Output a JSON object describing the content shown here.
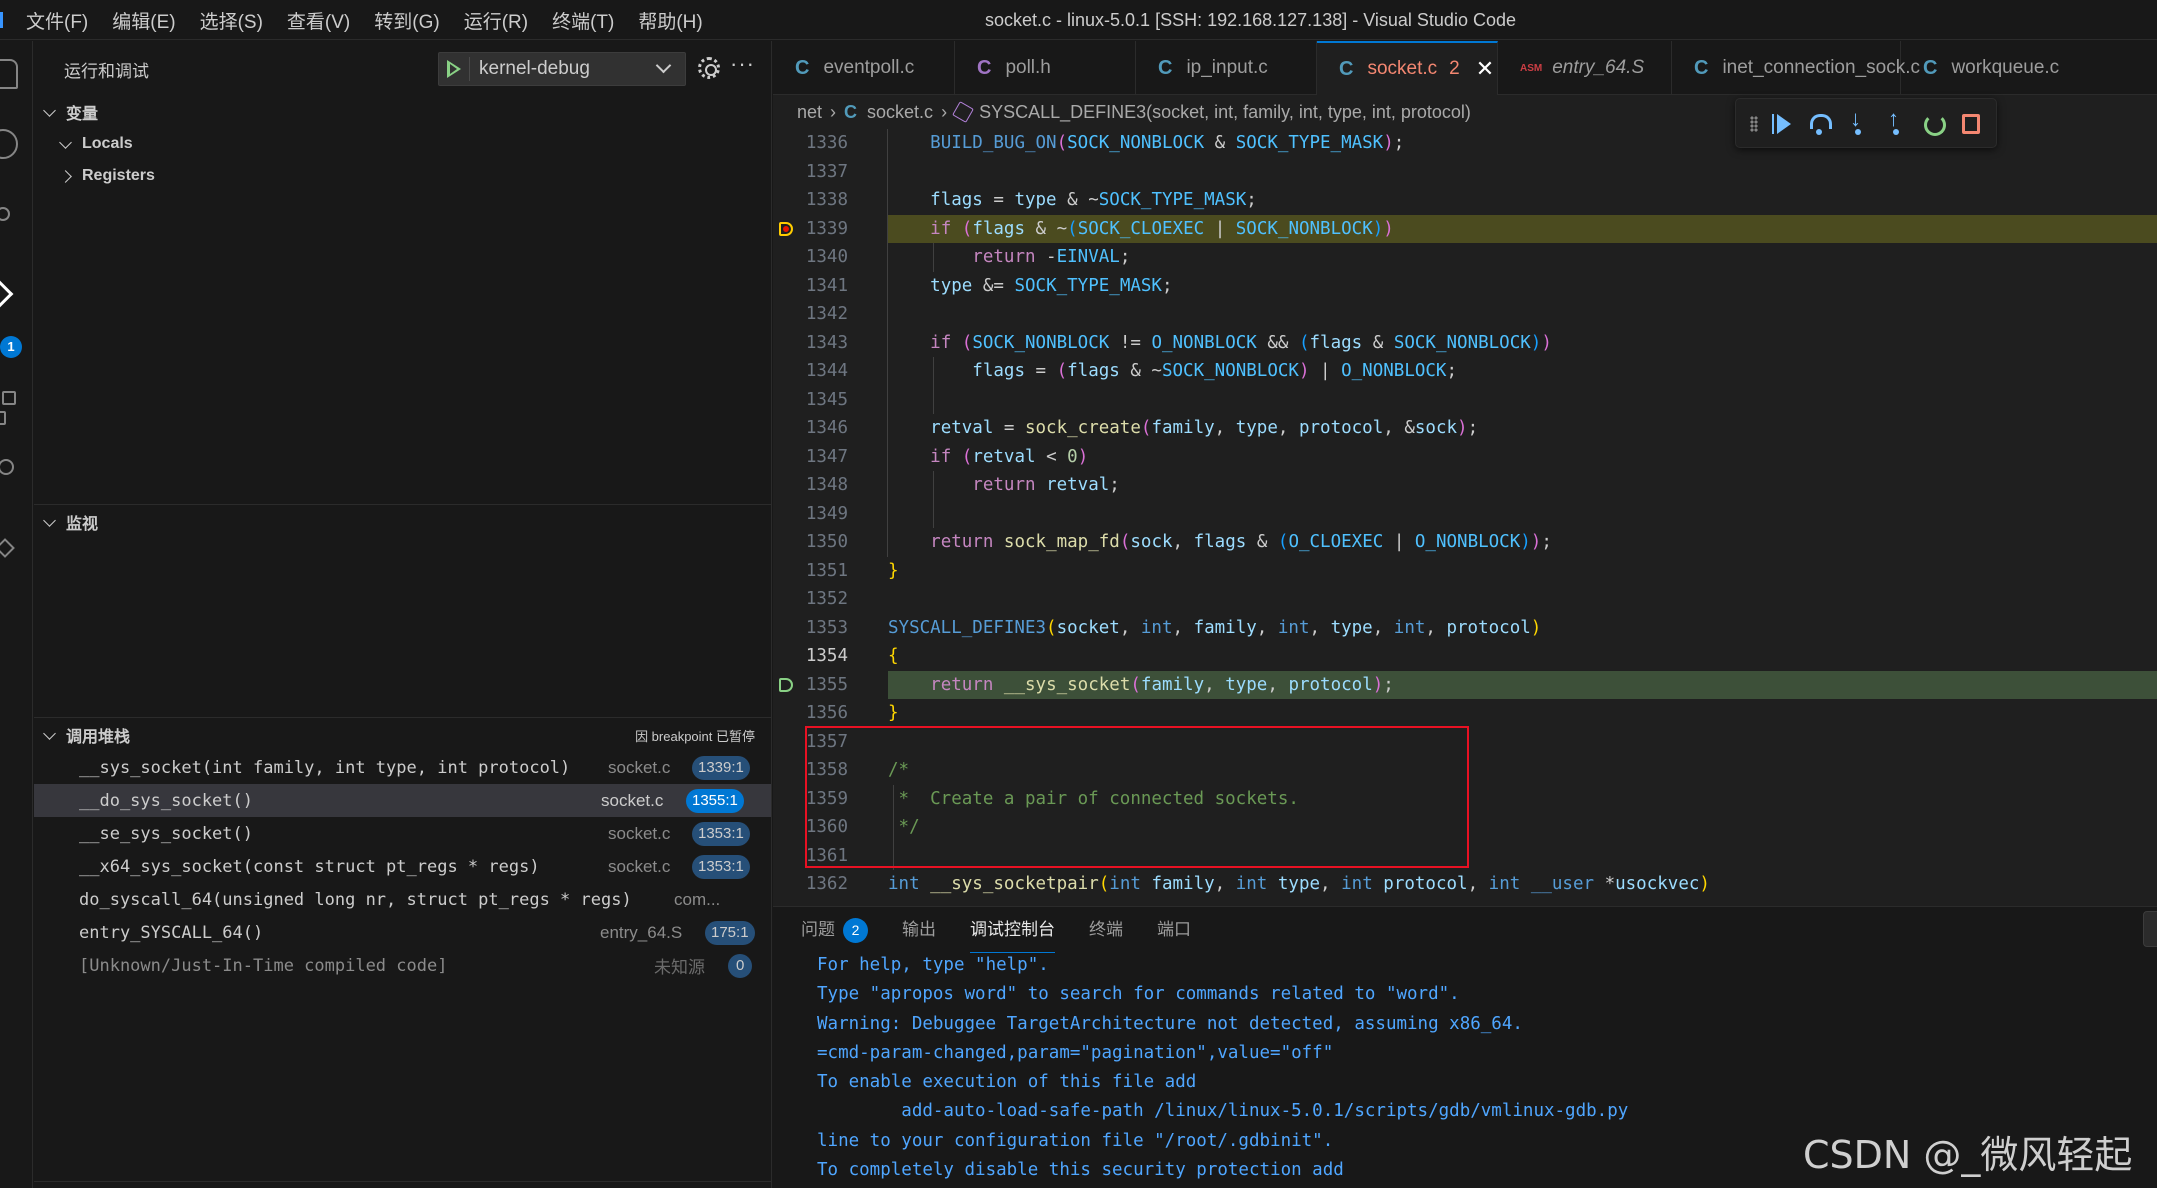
{
  "titlebar": {
    "menus": [
      "文件(F)",
      "编辑(E)",
      "选择(S)",
      "查看(V)",
      "转到(G)",
      "运行(R)",
      "终端(T)",
      "帮助(H)"
    ],
    "window_title": "socket.c - linux-5.0.1 [SSH: 192.168.127.138] - Visual Studio Code"
  },
  "activitybar": {
    "icons": [
      "files-icon",
      "search-icon",
      "source-control-icon",
      "run-debug-icon",
      "extensions-icon",
      "remote-explorer-icon",
      "testing-icon"
    ],
    "debug_badge": "1"
  },
  "sidebar": {
    "title": "运行和调试",
    "debug_config": "kernel-debug",
    "variables": {
      "header": "变量",
      "scopes": [
        {
          "label": "Locals",
          "expanded": true
        },
        {
          "label": "Registers",
          "expanded": false
        }
      ]
    },
    "watch": {
      "header": "监视"
    },
    "callstack": {
      "header": "调用堆栈",
      "paused_reason": "因 breakpoint 已暂停",
      "frames": [
        {
          "fn": "__sys_socket(int family, int type, int protocol)",
          "file": "socket.c",
          "line": "1339:1",
          "selected": false
        },
        {
          "fn": "__do_sys_socket()",
          "file": "socket.c",
          "line": "1355:1",
          "selected": true
        },
        {
          "fn": "__se_sys_socket()",
          "file": "socket.c",
          "line": "1353:1",
          "selected": false
        },
        {
          "fn": "__x64_sys_socket(const struct pt_regs * regs)",
          "file": "socket.c",
          "line": "1353:1",
          "selected": false
        },
        {
          "fn": "do_syscall_64(unsigned long nr, struct pt_regs * regs)",
          "file": "com...",
          "line": "",
          "selected": false
        },
        {
          "fn": "entry_SYSCALL_64()",
          "file": "entry_64.S",
          "line": "175:1",
          "selected": false
        },
        {
          "fn": "[Unknown/Just-In-Time compiled code]",
          "file": "未知源",
          "line": "0",
          "selected": false,
          "dim": true
        }
      ]
    }
  },
  "editor": {
    "tabs": [
      {
        "label": "eventpoll.c",
        "icon": "C",
        "active": false
      },
      {
        "label": "poll.h",
        "icon": "C",
        "active": false
      },
      {
        "label": "ip_input.c",
        "icon": "C",
        "active": false
      },
      {
        "label": "socket.c",
        "icon": "C",
        "active": true,
        "problems": "2",
        "close": "✕"
      },
      {
        "label": "entry_64.S",
        "icon": "ASM",
        "active": false,
        "italic": true
      },
      {
        "label": "inet_connection_sock.c",
        "icon": "C",
        "active": false
      },
      {
        "label": "workqueue.c",
        "icon": "C",
        "active": false
      }
    ],
    "breadcrumbs": {
      "folder": "net",
      "file_icon": "C",
      "file": "socket.c",
      "symbol": "SYSCALL_DEFINE3(socket, int, family, int, type, int, protocol)"
    },
    "debug_toolbar": [
      "drag-grip",
      "continue",
      "step-over",
      "step-into",
      "step-out",
      "restart",
      "stop"
    ],
    "lines": [
      {
        "num": "1336",
        "html": "    <span class='mf'>BUILD_BUG_ON</span><span class='p2'>(</span><span class='m'>SOCK_NONBLOCK</span> & <span class='m'>SOCK_TYPE_MASK</span><span class='p2'>)</span>;"
      },
      {
        "num": "1337",
        "html": ""
      },
      {
        "num": "1338",
        "html": "    <span class='v'>flags</span> = <span class='v'>type</span> & ~<span class='m'>SOCK_TYPE_MASK</span>;"
      },
      {
        "num": "1339",
        "html": "    <span class='k'>if</span> <span class='p2'>(</span><span class='v'>flags</span> & ~<span class='p3'>(</span><span class='m'>SOCK_CLOEXEC</span> | <span class='m'>SOCK_NONBLOCK</span><span class='p3'>)</span><span class='p2'>)</span>",
        "highlight": "yellow",
        "gutter": "breakpoint-paused"
      },
      {
        "num": "1340",
        "html": "        <span class='k'>return</span> -<span class='m'>EINVAL</span>;"
      },
      {
        "num": "1341",
        "html": "    <span class='v'>type</span> &= <span class='m'>SOCK_TYPE_MASK</span>;"
      },
      {
        "num": "1342",
        "html": ""
      },
      {
        "num": "1343",
        "html": "    <span class='k'>if</span> <span class='p2'>(</span><span class='m'>SOCK_NONBLOCK</span> != <span class='m'>O_NONBLOCK</span> && <span class='p3'>(</span><span class='v'>flags</span> & <span class='m'>SOCK_NONBLOCK</span><span class='p3'>)</span><span class='p2'>)</span>"
      },
      {
        "num": "1344",
        "html": "        <span class='v'>flags</span> = <span class='p2'>(</span><span class='v'>flags</span> & ~<span class='m'>SOCK_NONBLOCK</span><span class='p2'>)</span> | <span class='m'>O_NONBLOCK</span>;"
      },
      {
        "num": "1345",
        "html": ""
      },
      {
        "num": "1346",
        "html": "    <span class='v'>retval</span> = <span class='f'>sock_create</span><span class='p2'>(</span><span class='v'>family</span>, <span class='v'>type</span>, <span class='v'>protocol</span>, &<span class='v'>sock</span><span class='p2'>)</span>;"
      },
      {
        "num": "1347",
        "html": "    <span class='k'>if</span> <span class='p2'>(</span><span class='v'>retval</span> < <span class='n'>0</span><span class='p2'>)</span>"
      },
      {
        "num": "1348",
        "html": "        <span class='k'>return</span> <span class='v'>retval</span>;"
      },
      {
        "num": "1349",
        "html": ""
      },
      {
        "num": "1350",
        "html": "    <span class='k'>return</span> <span class='f'>sock_map_fd</span><span class='p2'>(</span><span class='v'>sock</span>, <span class='v'>flags</span> & <span class='p3'>(</span><span class='m'>O_CLOEXEC</span> | <span class='m'>O_NONBLOCK</span><span class='p3'>)</span><span class='p2'>)</span>;"
      },
      {
        "num": "1351",
        "html": "<span class='p1'>}</span>"
      },
      {
        "num": "1352",
        "html": ""
      },
      {
        "num": "1353",
        "html": "<span class='mf'>SYSCALL_DEFINE3</span><span class='p1'>(</span><span class='v'>socket</span>, <span class='t'>int</span>, <span class='v'>family</span>, <span class='t'>int</span>, <span class='v'>type</span>, <span class='t'>int</span>, <span class='v'>protocol</span><span class='p1'>)</span>"
      },
      {
        "num": "1354",
        "html": "<span class='p1'>{</span>",
        "current": true
      },
      {
        "num": "1355",
        "html": "    <span class='k'>return</span> <span class='f'>__sys_socket</span><span class='p2'>(</span><span class='v'>family</span>, <span class='v'>type</span>, <span class='v'>protocol</span><span class='p2'>)</span>;",
        "highlight": "green",
        "gutter": "stack-frame"
      },
      {
        "num": "1356",
        "html": "<span class='p1'>}</span>"
      },
      {
        "num": "1357",
        "html": ""
      },
      {
        "num": "1358",
        "html": "<span class='c'>/*</span>"
      },
      {
        "num": "1359",
        "html": "<span class='c'> *  Create a pair of connected sockets.</span>"
      },
      {
        "num": "1360",
        "html": "<span class='c'> */</span>"
      },
      {
        "num": "1361",
        "html": ""
      },
      {
        "num": "1362",
        "html": "<span class='t'>int</span> <span class='f'>__sys_socketpair</span><span class='p1'>(</span><span class='t'>int</span> <span class='v'>family</span>, <span class='t'>int</span> <span class='v'>type</span>, <span class='t'>int</span> <span class='v'>protocol</span>, <span class='t'>int</span> <span class='t'>__user</span> *<span class='v'>usockvec</span><span class='p1'>)</span>"
      }
    ]
  },
  "panel": {
    "tabs": [
      {
        "label": "问题",
        "badge": "2",
        "active": false
      },
      {
        "label": "输出",
        "active": false
      },
      {
        "label": "调试控制台",
        "active": true
      },
      {
        "label": "终端",
        "active": false
      },
      {
        "label": "端口",
        "active": false
      }
    ],
    "console_lines": [
      "For help, type \"help\".",
      "Type \"apropos word\" to search for commands related to \"word\".",
      "Warning: Debuggee TargetArchitecture not detected, assuming x86_64.",
      "=cmd-param-changed,param=\"pagination\",value=\"off\"",
      "To enable execution of this file add",
      "        add-auto-load-safe-path /linux/linux-5.0.1/scripts/gdb/vmlinux-gdb.py",
      "line to your configuration file \"/root/.gdbinit\".",
      "To completely disable this security protection add"
    ]
  },
  "watermark": "CSDN @_微风轻起",
  "colors": {
    "accent": "#0078d4",
    "paused_line": "#4b4b1f",
    "frame_line": "#3d5039",
    "annotation_box": "#e81123",
    "console_text": "#4fa6ff"
  }
}
